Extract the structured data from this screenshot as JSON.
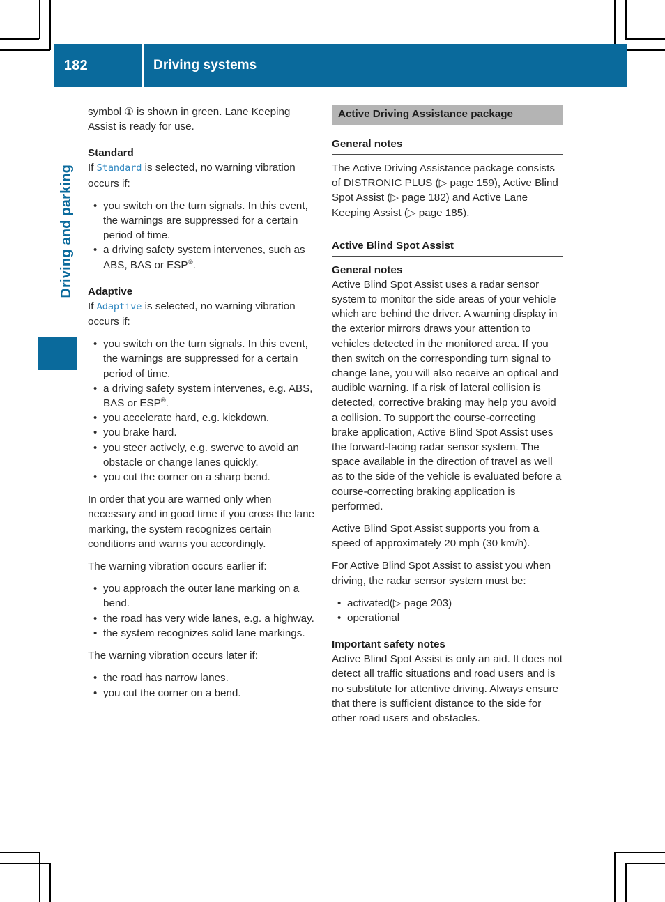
{
  "header": {
    "page_number": "182",
    "chapter_title": "Driving systems",
    "side_chapter": "Driving and parking",
    "accent_color": "#0a6a9c"
  },
  "left_column": {
    "intro": "symbol ① is shown in green. Lane Keeping Assist is ready for use.",
    "standard": {
      "heading": "Standard",
      "lead_prefix": "If ",
      "lead_mono": "Standard",
      "lead_suffix": " is selected, no warning vibration occurs if:",
      "bullets": [
        "you switch on the turn signals. In this event, the warnings are suppressed for a certain period of time.",
        "a driving safety system intervenes, such as ABS, BAS or ESP®."
      ]
    },
    "adaptive": {
      "heading": "Adaptive",
      "lead_prefix": "If ",
      "lead_mono": "Adaptive",
      "lead_suffix": " is selected, no warning vibration occurs if:",
      "bullets": [
        "you switch on the turn signals. In this event, the warnings are suppressed for a certain period of time.",
        "a driving safety system intervenes, e.g. ABS, BAS or ESP®.",
        "you accelerate hard, e.g. kickdown.",
        "you brake hard.",
        "you steer actively, e.g. swerve to avoid an obstacle or change lanes quickly.",
        "you cut the corner on a sharp bend."
      ]
    },
    "conditions_para": "In order that you are warned only when necessary and in good time if you cross the lane marking, the system recognizes certain conditions and warns you accordingly.",
    "earlier_lead": "The warning vibration occurs earlier if:",
    "earlier_bullets": [
      "you approach the outer lane marking on a bend.",
      "the road has very wide lanes, e.g. a highway.",
      "the system recognizes solid lane markings."
    ],
    "later_lead": "The warning vibration occurs later if:",
    "later_bullets": [
      "the road has narrow lanes.",
      "you cut the corner on a bend."
    ]
  },
  "right_column": {
    "package_bar": "Active Driving Assistance package",
    "general_notes_heading_1": "General notes",
    "package_para_part1": "The Active Driving Assistance package consists of DISTRONIC PLUS (",
    "package_ref1": "▷ page 159",
    "package_para_part2": "), Active Blind Spot Assist (",
    "package_ref2": "▷ page 182",
    "package_para_part3": ") and Active Lane Keeping Assist (",
    "package_ref3": "▷ page 185",
    "package_para_part4": ").",
    "blind_spot_heading": "Active Blind Spot Assist",
    "general_notes_heading_2": "General notes",
    "blind_spot_para_1": "Active Blind Spot Assist uses a radar sensor system to monitor the side areas of your vehicle which are behind the driver. A warning display in the exterior mirrors draws your attention to vehicles detected in the monitored area. If you then switch on the corresponding turn signal to change lane, you will also receive an optical and audible warning. If a risk of lateral collision is detected, corrective braking may help you avoid a collision. To support the course-correcting brake application, Active Blind Spot Assist uses the forward-facing radar sensor system. The space available in the direction of travel as well as to the side of the vehicle is evaluated before a course-correcting braking application is performed.",
    "blind_spot_para_2": "Active Blind Spot Assist supports you from a speed of approximately 20 mph (30 km/h).",
    "blind_spot_para_3": "For Active Blind Spot Assist to assist you when driving, the radar sensor system must be:",
    "requirement_bullet_1_text": "activated(",
    "requirement_bullet_1_ref": "▷ page 203",
    "requirement_bullet_1_close": ")",
    "requirement_bullet_2": "operational",
    "safety_heading": "Important safety notes",
    "safety_para": "Active Blind Spot Assist is only an aid. It does not detect all traffic situations and road users and is no substitute for attentive driving. Always ensure that there is sufficient distance to the side for other road users and obstacles."
  }
}
